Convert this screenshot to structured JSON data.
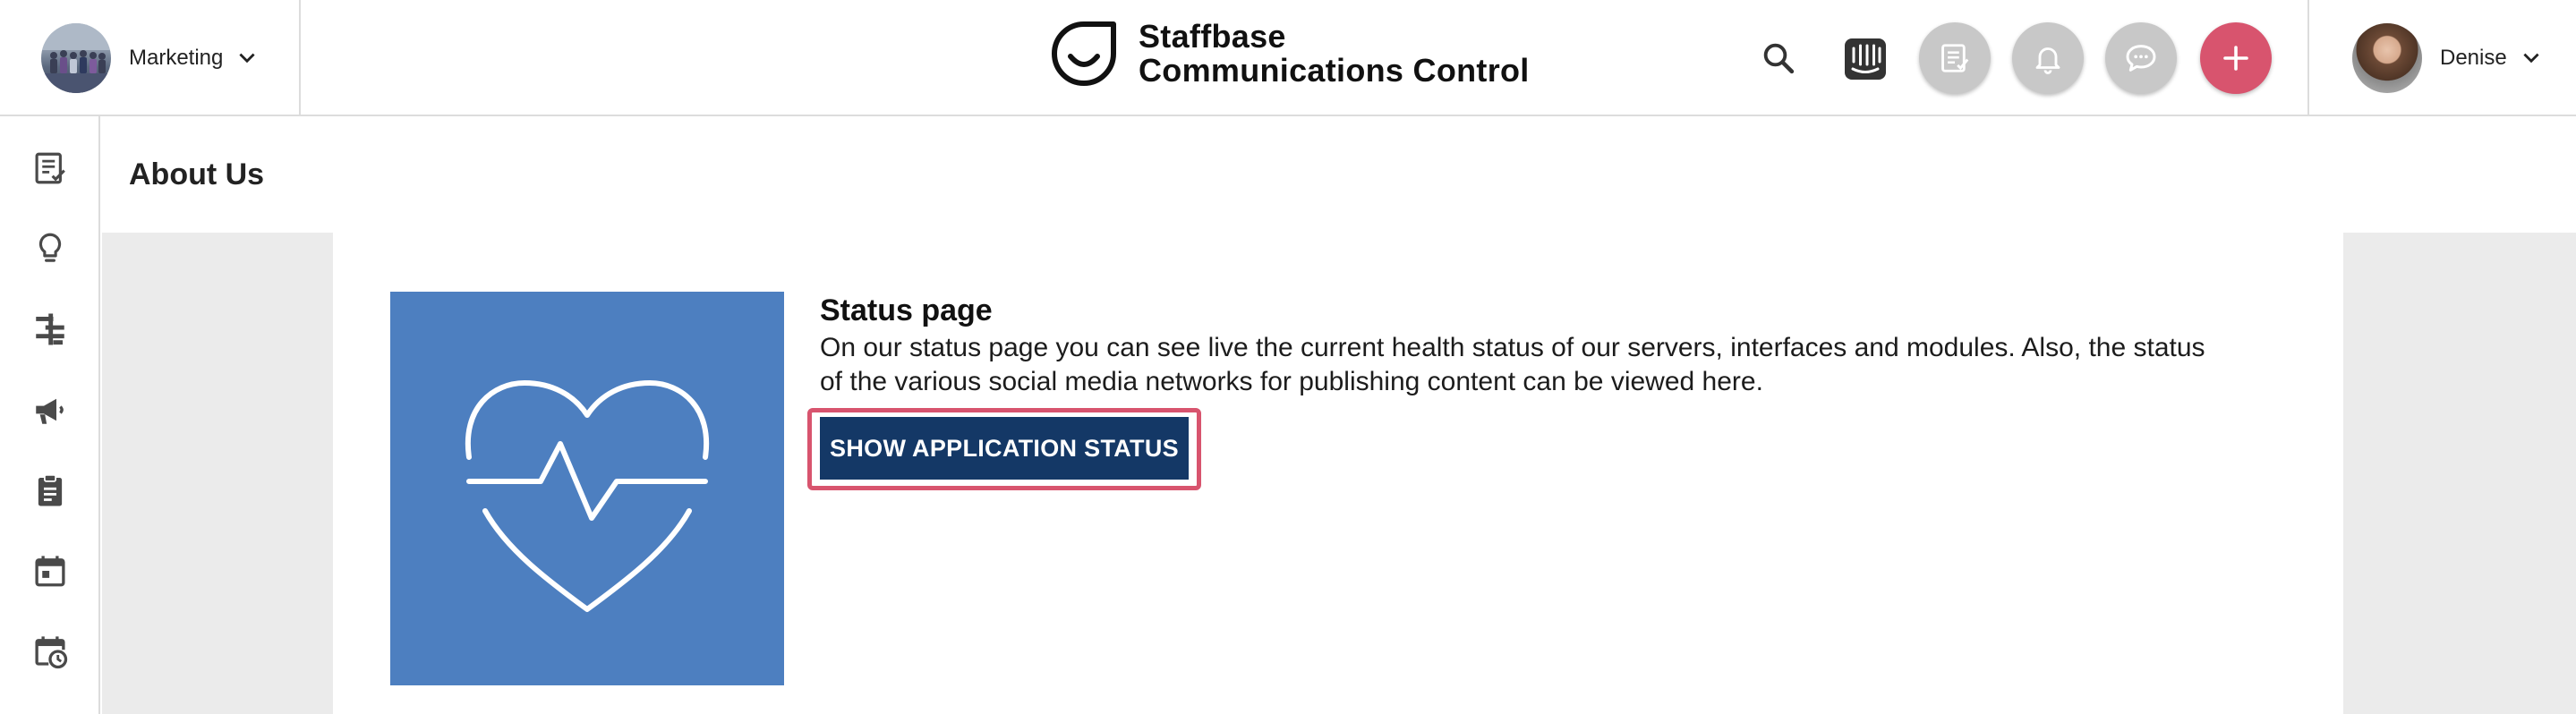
{
  "header": {
    "group": {
      "name": "Marketing"
    },
    "brand": {
      "line1": "Staffbase",
      "line2": "Communications Control"
    },
    "icons": {
      "search": "search-icon",
      "intercom": "intercom-icon",
      "news": "news-icon",
      "notifications": "bell-icon",
      "chat": "chat-icon",
      "create": "plus-icon"
    },
    "user": {
      "name": "Denise"
    }
  },
  "sidebar": {
    "items": [
      {
        "icon": "posts-review-icon"
      },
      {
        "icon": "lightbulb-icon"
      },
      {
        "icon": "hierarchy-icon"
      },
      {
        "icon": "megaphone-icon"
      },
      {
        "icon": "clipboard-icon"
      },
      {
        "icon": "calendar-icon"
      },
      {
        "icon": "calendar-clock-icon"
      }
    ]
  },
  "main": {
    "page_title": "About Us",
    "status_section": {
      "tile_icon": "heart-pulse-icon",
      "heading": "Status page",
      "description": "On our status page you can see live the current health status of our servers, interfaces and modules. Also, the status of the various social media networks for publishing content can be viewed here.",
      "button_label": "SHOW APPLICATION STATUS"
    }
  },
  "colors": {
    "accent_pink": "#d8546e",
    "button_navy": "#143866",
    "tile_blue": "#4d7fc0",
    "content_gray": "#ebebeb"
  }
}
